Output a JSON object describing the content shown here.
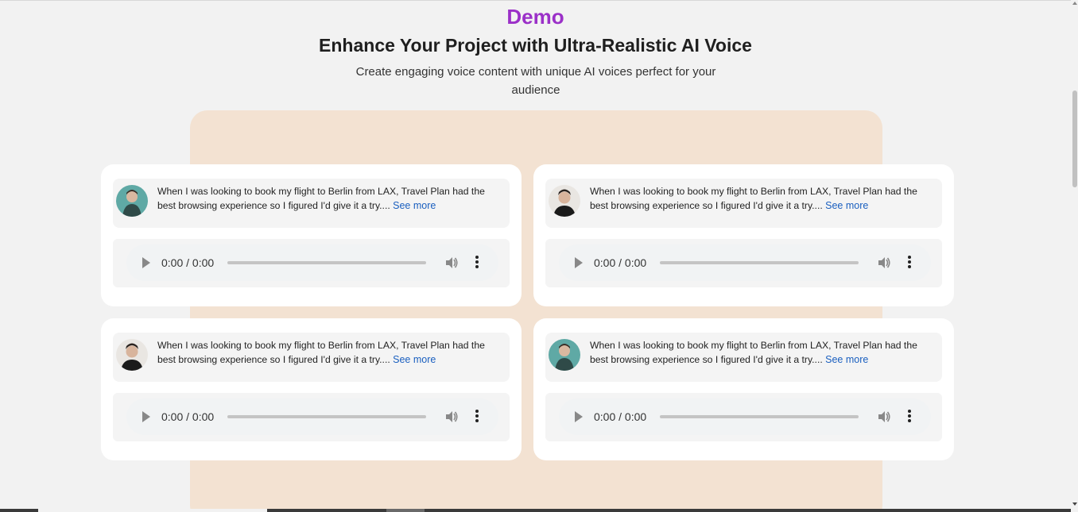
{
  "header": {
    "eyebrow": "Demo",
    "title": "Enhance Your Project with Ultra-Realistic AI Voice",
    "subtitle": "Create engaging voice content with unique AI voices perfect for your audience"
  },
  "cards": [
    {
      "avatar": "teal-portrait",
      "quote": "When I was looking to book my flight to Berlin from LAX, Travel Plan had the best browsing experience so I figured I'd give it a try....",
      "see_more": "See more",
      "time": "0:00 / 0:00"
    },
    {
      "avatar": "man-portrait",
      "quote": "When I was looking to book my flight to Berlin from LAX, Travel Plan had the best browsing experience so I figured I'd give it a try....",
      "see_more": "See more",
      "time": "0:00 / 0:00"
    },
    {
      "avatar": "man-portrait",
      "quote": "When I was looking to book my flight to Berlin from LAX, Travel Plan had the best browsing experience so I figured I'd give it a try....",
      "see_more": "See more",
      "time": "0:00 / 0:00"
    },
    {
      "avatar": "teal-portrait",
      "quote": "When I was looking to book my flight to Berlin from LAX, Travel Plan had the best browsing experience so I figured I'd give it a try....",
      "see_more": "See more",
      "time": "0:00 / 0:00"
    }
  ],
  "colors": {
    "accent": "#9b30c8",
    "link": "#1a5fbf",
    "panel": "#f3e2d2"
  }
}
